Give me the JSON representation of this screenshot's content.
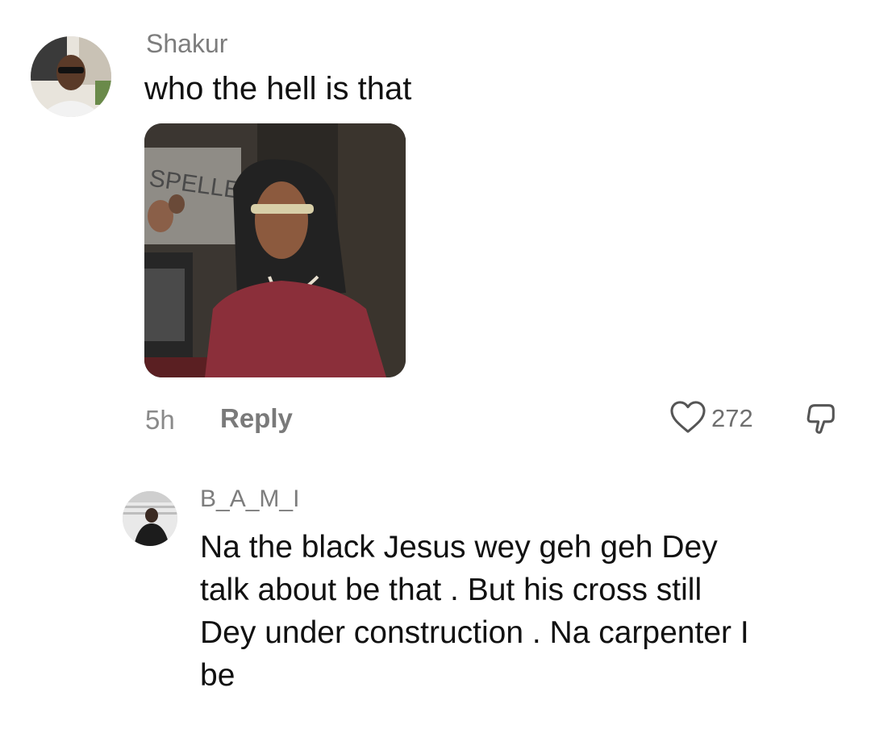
{
  "comments": [
    {
      "username": "Shakur",
      "text": "who the hell is that",
      "media_alt": "GIF of a man with long hair and glasses in a maroon shirt",
      "media_visible_text": "SPELLER",
      "timestamp": "5h",
      "reply_label": "Reply",
      "like_count": "272"
    },
    {
      "username": "B_A_M_I",
      "text_lines": [
        "Na the black Jesus wey geh geh Dey",
        "talk about be that . But his cross still",
        "Dey under construction . Na carpenter I",
        "be"
      ]
    }
  ],
  "icons": {
    "like": "heart-outline-icon",
    "dislike": "thumbs-down-icon"
  },
  "colors": {
    "username": "#7d7d7d",
    "text": "#111111",
    "meta": "#8a8a8a"
  }
}
